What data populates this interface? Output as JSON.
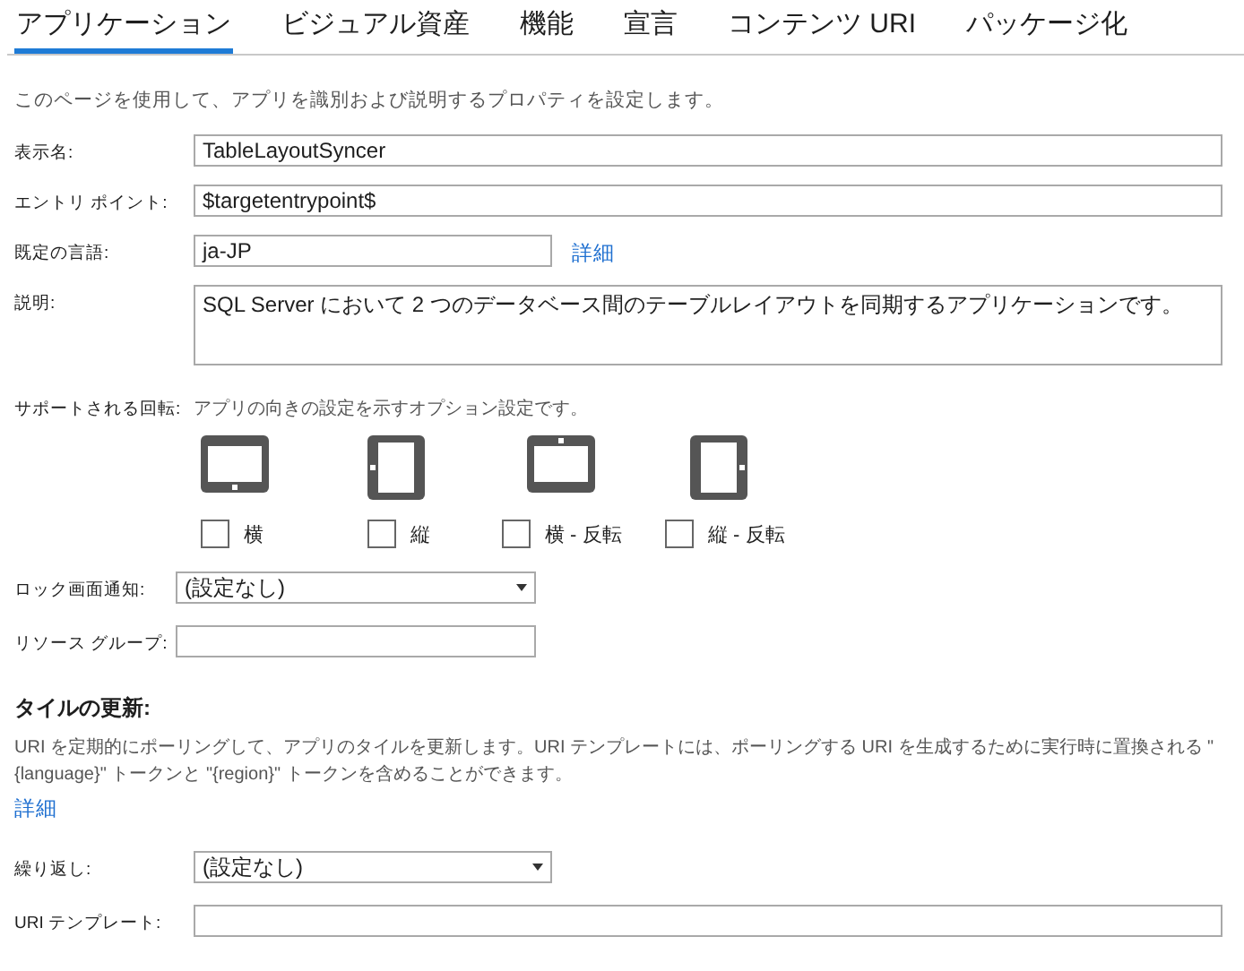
{
  "tabs": [
    {
      "label": "アプリケーション",
      "selected": true
    },
    {
      "label": "ビジュアル資産",
      "selected": false
    },
    {
      "label": "機能",
      "selected": false
    },
    {
      "label": "宣言",
      "selected": false
    },
    {
      "label": "コンテンツ URI",
      "selected": false
    },
    {
      "label": "パッケージ化",
      "selected": false
    }
  ],
  "intro": "このページを使用して、アプリを識別および説明するプロパティを設定します。",
  "fields": [
    {
      "kind": "text",
      "label": "表示名:",
      "value": "TableLayoutSyncer"
    },
    {
      "kind": "text",
      "label": "エントリ ポイント:",
      "value": "$targetentrypoint$"
    },
    {
      "kind": "short",
      "label": "既定の言語:",
      "value": "ja-JP",
      "link": "詳細"
    },
    {
      "kind": "textarea",
      "label": "説明:",
      "value": "SQL Server において 2 つのデータベース間のテーブルレイアウトを同期するアプリケーションです。"
    }
  ],
  "rotation": {
    "label": "サポートされる回転:",
    "hint": "アプリの向きの設定を示すオプション設定です。",
    "options": [
      {
        "kind": "landscape",
        "label": "横",
        "checked": false
      },
      {
        "kind": "portrait",
        "label": "縦",
        "checked": false
      },
      {
        "kind": "landscape-flipped",
        "label": "横 - 反転",
        "checked": false
      },
      {
        "kind": "portrait-flipped",
        "label": "縦 - 反転",
        "checked": false
      }
    ]
  },
  "lock_fields": [
    {
      "kind": "dropdown",
      "label": "ロック画面通知:",
      "value": "(設定なし)"
    },
    {
      "kind": "text",
      "label": "リソース グループ:"
    }
  ],
  "tile_update": {
    "title": "タイルの更新:",
    "description": "URI を定期的にポーリングして、アプリのタイルを更新します。URI テンプレートには、ポーリングする URI を生成するために実行時に置換される \"{language}\" トークンと \"{region}\" トークンを含めることができます。",
    "link": "詳細",
    "fields": [
      {
        "kind": "dropdown",
        "label": "繰り返し:",
        "value": "(設定なし)"
      },
      {
        "kind": "text",
        "label": "URI テンプレート:"
      }
    ]
  }
}
